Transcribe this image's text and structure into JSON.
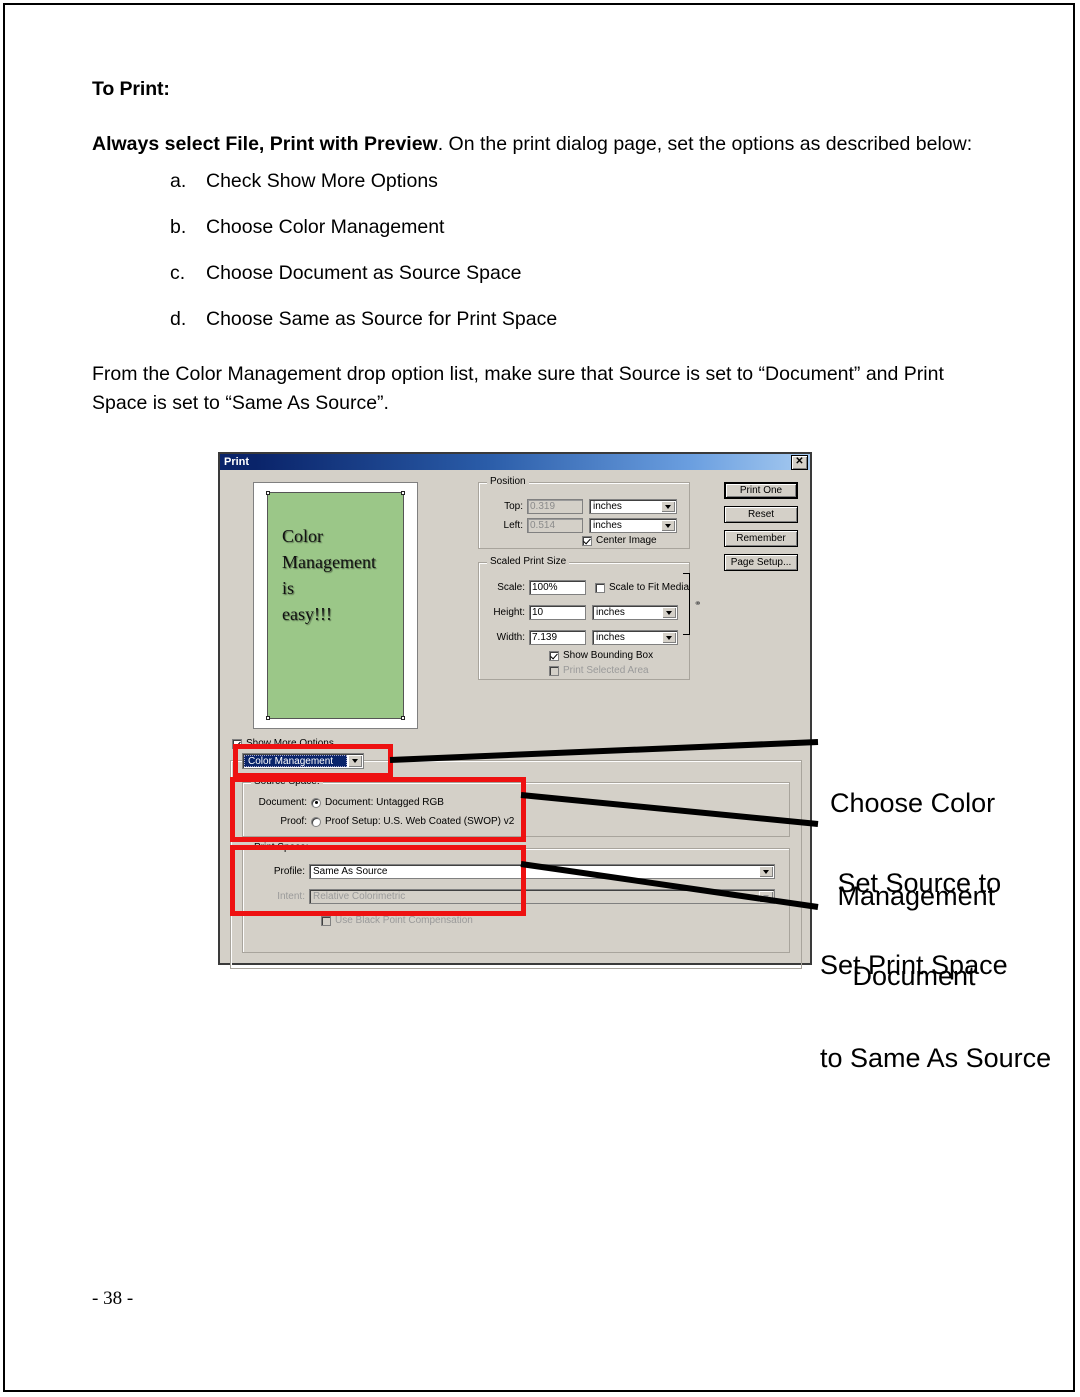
{
  "document": {
    "heading": "To Print:",
    "intro_bold": "Always select File, Print with Preview",
    "intro_rest": ".  On the print dialog page, set the options as described below:",
    "steps": [
      {
        "marker": "a.",
        "text": "Check Show More Options"
      },
      {
        "marker": "b.",
        "text": "Choose Color Management"
      },
      {
        "marker": "c.",
        "text": "Choose Document as Source Space"
      },
      {
        "marker": "d.",
        "text": "Choose Same as Source for Print Space"
      }
    ],
    "paragraph2": "From the Color Management drop option list, make sure that Source is set to “Document” and Print Space is set to “Same As Source”.",
    "page_footer": "- 38 -"
  },
  "figure": {
    "dialog": {
      "title": "Print",
      "close_label": "✕",
      "preview": {
        "line1": "Color",
        "line2": "Management",
        "line3": "is",
        "line4": "easy!!!",
        "background_color": "#9bc788"
      },
      "position_group": {
        "legend": "Position",
        "top_label": "Top:",
        "top_value": "0.319",
        "top_units": "inches",
        "left_label": "Left:",
        "left_value": "0.514",
        "left_units": "inches",
        "center_image_label": "Center Image",
        "center_image_checked": true
      },
      "scaled_group": {
        "legend": "Scaled Print Size",
        "scale_label": "Scale:",
        "scale_value": "100%",
        "scale_to_fit_label": "Scale to Fit Media",
        "scale_to_fit_checked": false,
        "height_label": "Height:",
        "height_value": "10",
        "height_units": "inches",
        "width_label": "Width:",
        "width_value": "7.139",
        "width_units": "inches",
        "show_bounding_box_label": "Show Bounding Box",
        "show_bounding_box_checked": true,
        "print_selected_area_label": "Print Selected Area",
        "print_selected_area_checked": false,
        "link_icon": "⚭"
      },
      "buttons": [
        {
          "label": "Print One"
        },
        {
          "label": "Reset"
        },
        {
          "label": "Remember"
        },
        {
          "label": "Page Setup..."
        }
      ],
      "show_more_options_label": "Show More Options",
      "show_more_options_checked": true,
      "color_management_select": "Color Management",
      "source_space": {
        "legend": "Source Space:",
        "document_label": "Document:",
        "document_option": "Document:  Untagged RGB",
        "document_selected": true,
        "proof_label": "Proof:",
        "proof_option": "Proof Setup:  U.S. Web Coated (SWOP) v2",
        "proof_selected": false
      },
      "print_space": {
        "legend": "Print Space:",
        "profile_label": "Profile:",
        "profile_value": "Same As Source",
        "intent_label": "Intent:",
        "intent_value": "Relative Colorimetric",
        "black_point_label": "Use Black Point Compensation",
        "black_point_checked": false
      }
    },
    "annotations": [
      {
        "line1": "Choose Color",
        "line2": " Management"
      },
      {
        "line1": " Set Source to",
        "line2": "   Document"
      },
      {
        "line1": "Set Print Space",
        "line2": "to Same As Source"
      }
    ],
    "highlight_color": "#ee1111"
  }
}
